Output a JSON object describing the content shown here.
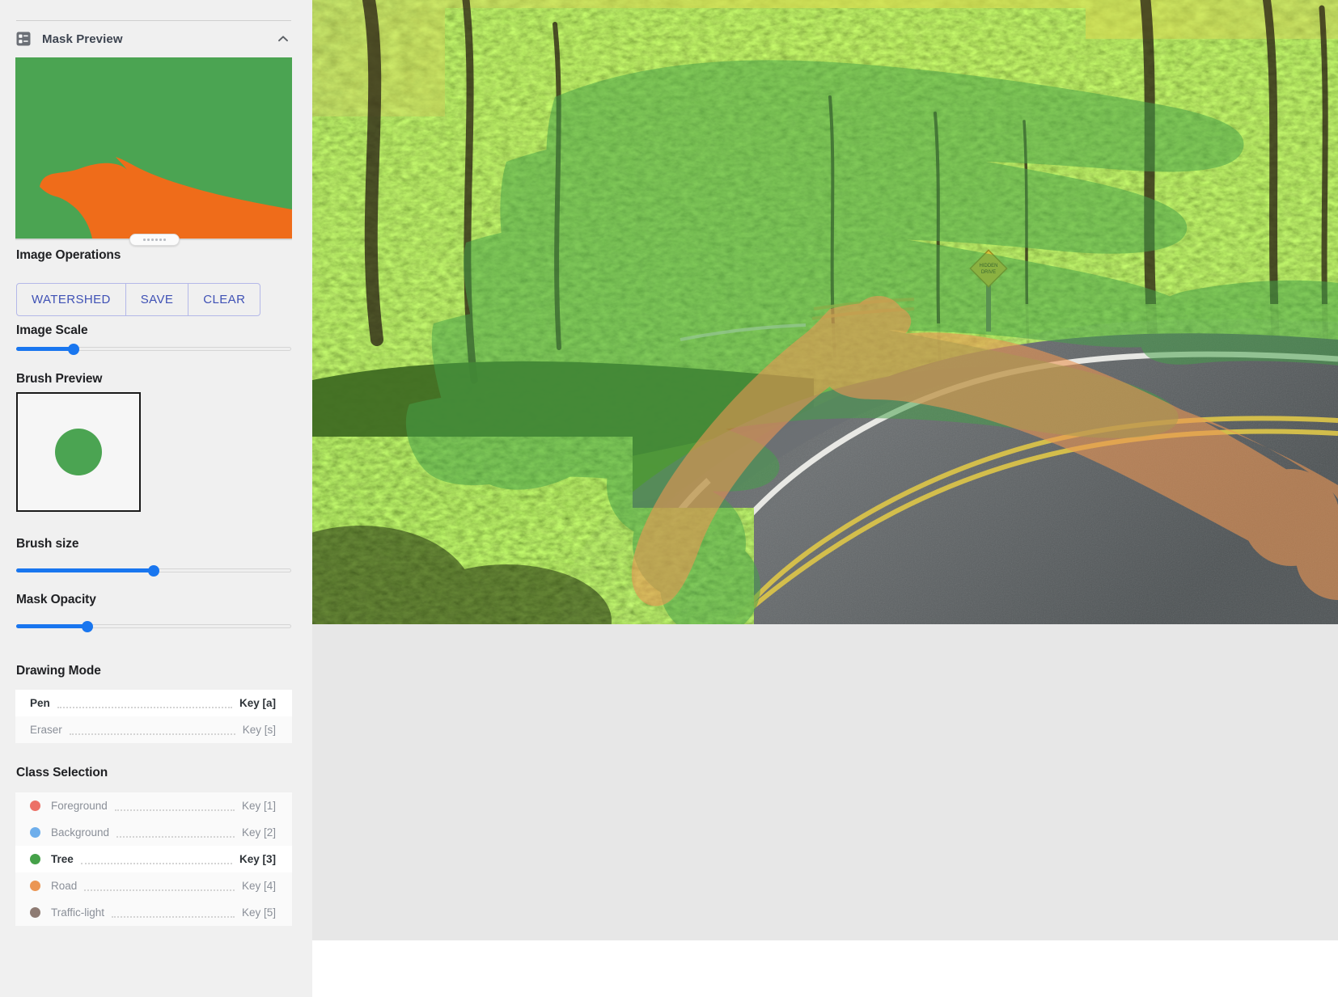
{
  "panel": {
    "header": {
      "icon": "list-box-icon",
      "title": "Mask Preview",
      "collapse_icon": "chevron-up-icon",
      "expanded": true
    },
    "mask_preview": {
      "background_class_color": "#4ba452",
      "foreground_class_color": "#ef6c1a",
      "resize_handle": "resize-grip"
    }
  },
  "image_operations": {
    "label": "Image Operations",
    "buttons": [
      {
        "label": "WATERSHED",
        "name": "watershed-button"
      },
      {
        "label": "SAVE",
        "name": "save-button"
      },
      {
        "label": "CLEAR",
        "name": "clear-button"
      }
    ]
  },
  "image_scale": {
    "label": "Image Scale",
    "value_pct": 21
  },
  "brush_preview": {
    "label": "Brush Preview",
    "brush_color": "#4ba452"
  },
  "brush_size": {
    "label": "Brush size",
    "value_pct": 50
  },
  "mask_opacity": {
    "label": "Mask Opacity",
    "value_pct": 26
  },
  "drawing_mode": {
    "label": "Drawing Mode",
    "selected": "Pen",
    "options": [
      {
        "label": "Pen",
        "key": "Key [a]",
        "selected": true
      },
      {
        "label": "Eraser",
        "key": "Key [s]",
        "selected": false
      }
    ]
  },
  "class_selection": {
    "label": "Class Selection",
    "selected": "Tree",
    "options": [
      {
        "label": "Foreground",
        "key": "Key [1]",
        "color": "#ec7167",
        "selected": false
      },
      {
        "label": "Background",
        "key": "Key [2]",
        "color": "#6eaeeb",
        "selected": false
      },
      {
        "label": "Tree",
        "key": "Key [3]",
        "color": "#45a149",
        "selected": true
      },
      {
        "label": "Road",
        "key": "Key [4]",
        "color": "#eb9654",
        "selected": false
      },
      {
        "label": "Traffic-light",
        "key": "Key [5]",
        "color": "#8e7b73",
        "selected": false
      }
    ]
  },
  "canvas": {
    "name": "annotation-canvas",
    "scene": "winding forest road lined with bright green spring foliage",
    "sign_text_line1": "HIDDEN",
    "sign_text_line2": "DRIVE",
    "overlays": [
      {
        "class": "Tree",
        "color": "#45a149"
      },
      {
        "class": "Road",
        "color": "#eb9654"
      }
    ]
  },
  "colors": {
    "accent_blue": "#1976ef",
    "button_text": "#3f51b5",
    "sidebar_bg": "#f0f0f0",
    "canvas_bg": "#e7e7e7"
  }
}
